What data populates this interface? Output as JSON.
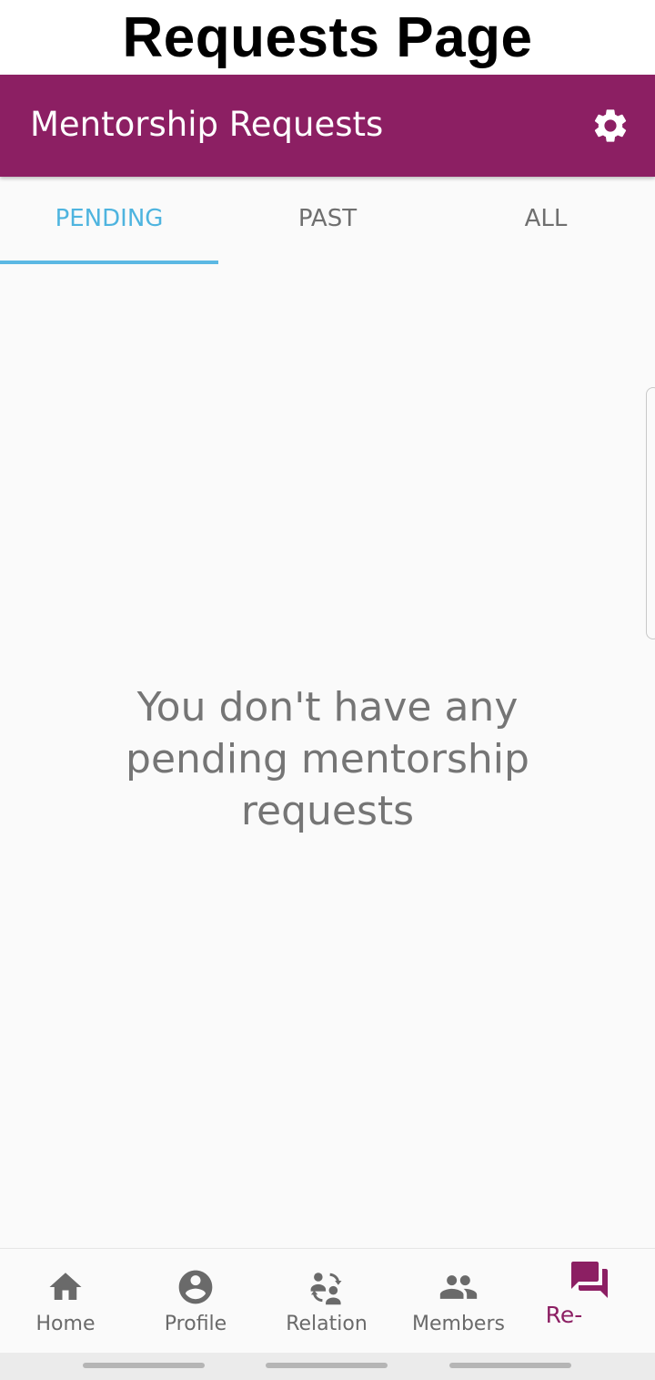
{
  "caption": "Requests Page",
  "app_bar": {
    "title": "Mentorship Requests",
    "settings_icon": "gear-icon",
    "color": "#8c1f63"
  },
  "tabs": [
    {
      "label": "PENDING",
      "active": true
    },
    {
      "label": "PAST",
      "active": false
    },
    {
      "label": "ALL",
      "active": false
    }
  ],
  "tab_active_color": "#4eb4df",
  "empty_state": {
    "line1": "You don't have any",
    "line2": "pending mentorship",
    "line3": "requests"
  },
  "bottom_nav": [
    {
      "label": "Home",
      "icon": "home-icon",
      "active": false
    },
    {
      "label": "Profile",
      "icon": "account-circle-icon",
      "active": false
    },
    {
      "label": "Relation",
      "icon": "people-swap-icon",
      "active": false
    },
    {
      "label": "Members",
      "icon": "people-icon",
      "active": false
    },
    {
      "label": "Re-",
      "icon": "forum-icon",
      "active": true
    }
  ]
}
